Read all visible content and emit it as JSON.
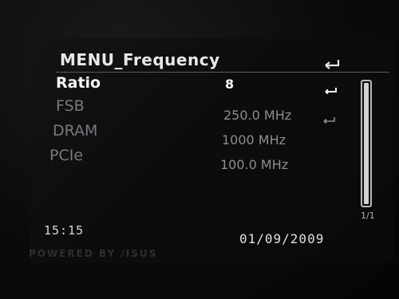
{
  "header": {
    "title": "MENU_Frequency",
    "back_icon": "return-arrow-icon"
  },
  "settings": [
    {
      "label": "Ratio",
      "value": "8",
      "selected": true,
      "icon": "enter-icon"
    },
    {
      "label": "FSB",
      "value": "250.0 MHz",
      "selected": false,
      "icon": "enter-icon"
    },
    {
      "label": "DRAM",
      "value": "1000  MHz",
      "selected": false
    },
    {
      "label": "PCIe",
      "value": "100.0  MHz",
      "selected": false
    }
  ],
  "scroll": {
    "page_indicator": "1/1"
  },
  "footer": {
    "time": "15:15",
    "date": "01/09/2009",
    "brand": "POWERED BY /ISUS"
  },
  "colors": {
    "background": "#0a0a0a",
    "selected_text": "#f4f4f4",
    "normal_text": "#777a80"
  }
}
